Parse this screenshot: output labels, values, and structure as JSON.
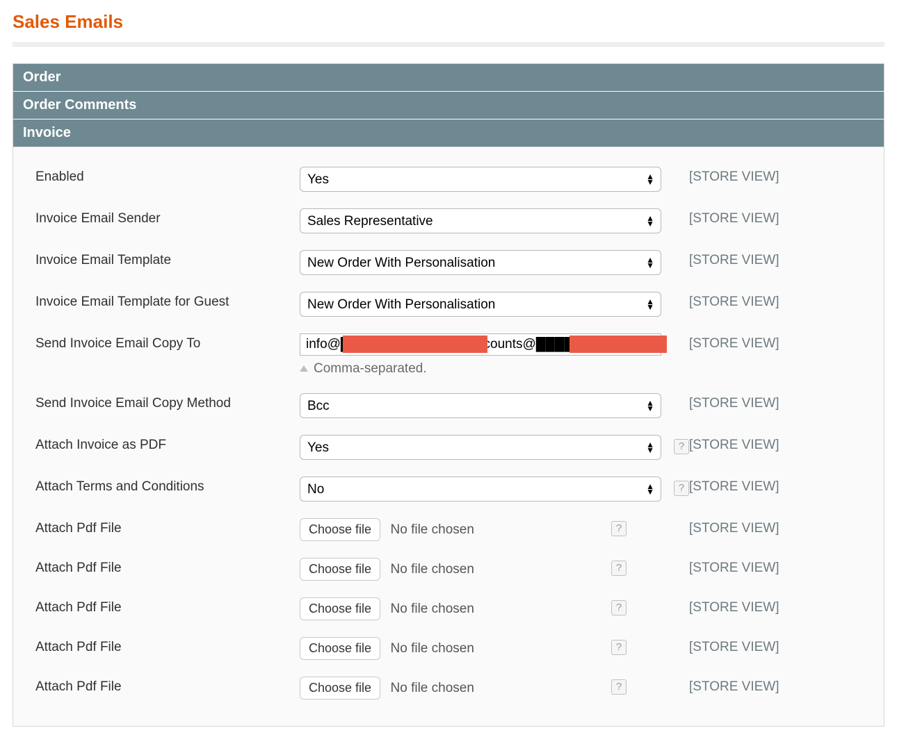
{
  "page": {
    "title": "Sales Emails"
  },
  "sections": {
    "order": {
      "title": "Order"
    },
    "order_comments": {
      "title": "Order Comments"
    },
    "invoice": {
      "title": "Invoice"
    }
  },
  "scope_label": "[STORE VIEW]",
  "help_glyph": "?",
  "invoice": {
    "enabled": {
      "label": "Enabled",
      "value": "Yes"
    },
    "sender": {
      "label": "Invoice Email Sender",
      "value": "Sales Representative"
    },
    "template": {
      "label": "Invoice Email Template",
      "value": "New Order With Personalisation"
    },
    "template_guest": {
      "label": "Invoice Email Template for Guest",
      "value": "New Order With Personalisation"
    },
    "copy_to": {
      "label": "Send Invoice Email Copy To",
      "value": "info@█████████████, accounts@███████████",
      "hint": "Comma-separated."
    },
    "copy_method": {
      "label": "Send Invoice Email Copy Method",
      "value": "Bcc"
    },
    "attach_pdf": {
      "label": "Attach Invoice as PDF",
      "value": "Yes"
    },
    "attach_terms": {
      "label": "Attach Terms and Conditions",
      "value": "No"
    },
    "file1": {
      "label": "Attach Pdf File",
      "button": "Choose file",
      "status": "No file chosen"
    },
    "file2": {
      "label": "Attach Pdf File",
      "button": "Choose file",
      "status": "No file chosen"
    },
    "file3": {
      "label": "Attach Pdf File",
      "button": "Choose file",
      "status": "No file chosen"
    },
    "file4": {
      "label": "Attach Pdf File",
      "button": "Choose file",
      "status": "No file chosen"
    },
    "file5": {
      "label": "Attach Pdf File",
      "button": "Choose file",
      "status": "No file chosen"
    }
  }
}
